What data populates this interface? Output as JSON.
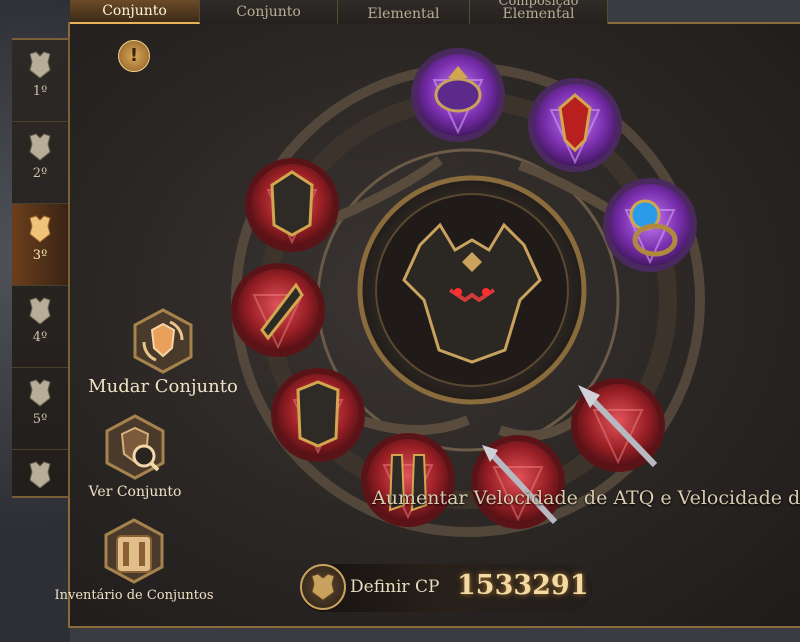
{
  "tabs": [
    {
      "label": "Conjunto",
      "active": true
    },
    {
      "label": "Conjunto",
      "active": false
    },
    {
      "label": "Elemental",
      "active": false
    },
    {
      "label": "Elemental",
      "active": false,
      "overflow_top": "Composição"
    }
  ],
  "sidenav": [
    {
      "label": "1º",
      "active": false
    },
    {
      "label": "2º",
      "active": false
    },
    {
      "label": "3º",
      "active": true
    },
    {
      "label": "4º",
      "active": false
    },
    {
      "label": "5º",
      "active": false
    },
    {
      "label": "",
      "active": false
    }
  ],
  "alert": {
    "symbol": "!"
  },
  "actions": {
    "change_set": "Mudar Conjunto",
    "view_set": "Ver Conjunto",
    "inventory": "Inventário de Conjuntos"
  },
  "equipment": {
    "center": "helmet-portrait",
    "slots": [
      {
        "name": "ring-item",
        "quality": "epic"
      },
      {
        "name": "earring-item",
        "quality": "epic"
      },
      {
        "name": "gem-ring-item",
        "quality": "epic"
      },
      {
        "name": "helmet-item",
        "quality": "legendary"
      },
      {
        "name": "gauntlet-item",
        "quality": "legendary"
      },
      {
        "name": "chest-armor-item",
        "quality": "legendary"
      },
      {
        "name": "boots-item",
        "quality": "legendary"
      },
      {
        "name": "trident-item",
        "quality": "legendary"
      },
      {
        "name": "spear-item",
        "quality": "legendary"
      }
    ]
  },
  "tooltip": "Aumentar Velocidade de ATQ e Velocidade d",
  "cp": {
    "label": "Definir CP",
    "value": "1533291"
  },
  "colors": {
    "gold": "#c9a35e",
    "epic": "#8e3fc4",
    "legendary": "#b32a30",
    "accent": "#e6b45a"
  }
}
